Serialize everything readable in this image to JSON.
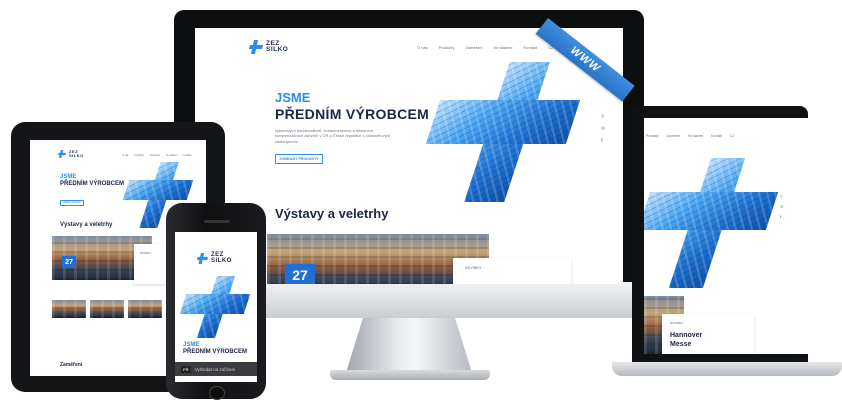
{
  "ribbon": {
    "label": "WWW"
  },
  "brand": {
    "line1": "ZEZ",
    "line2": "SILKO"
  },
  "nav": {
    "items": [
      "O nás",
      "Produkty",
      "Zaměření",
      "Ke stažení",
      "Kontakt",
      "CZ"
    ]
  },
  "hero": {
    "title_line1": "JSME",
    "title_line2": "PŘEDNÍM VÝROBCEM",
    "body": "výkonových kondenzátorů, kompenzačních a filtračních kompenzačních zařízení v ČR a České republice s celosvětovým zastoupením",
    "button": "ZOBRAZIT PRODUKTY"
  },
  "section": {
    "title": "Výstavy a veletrhy",
    "booth_number": "27"
  },
  "event_card": {
    "label": "NOVINKY",
    "title_line1": "Hannover",
    "title_line2": "Messe"
  },
  "tablet": {
    "extra_heading": "Zaměření"
  },
  "phone": {
    "search_prefix": "PŘ",
    "search_value": "Vyhledat na zařízení"
  },
  "colors": {
    "accent": "#2b8ee8",
    "navy": "#1b2546",
    "ribbon": "#2f7fd4"
  }
}
